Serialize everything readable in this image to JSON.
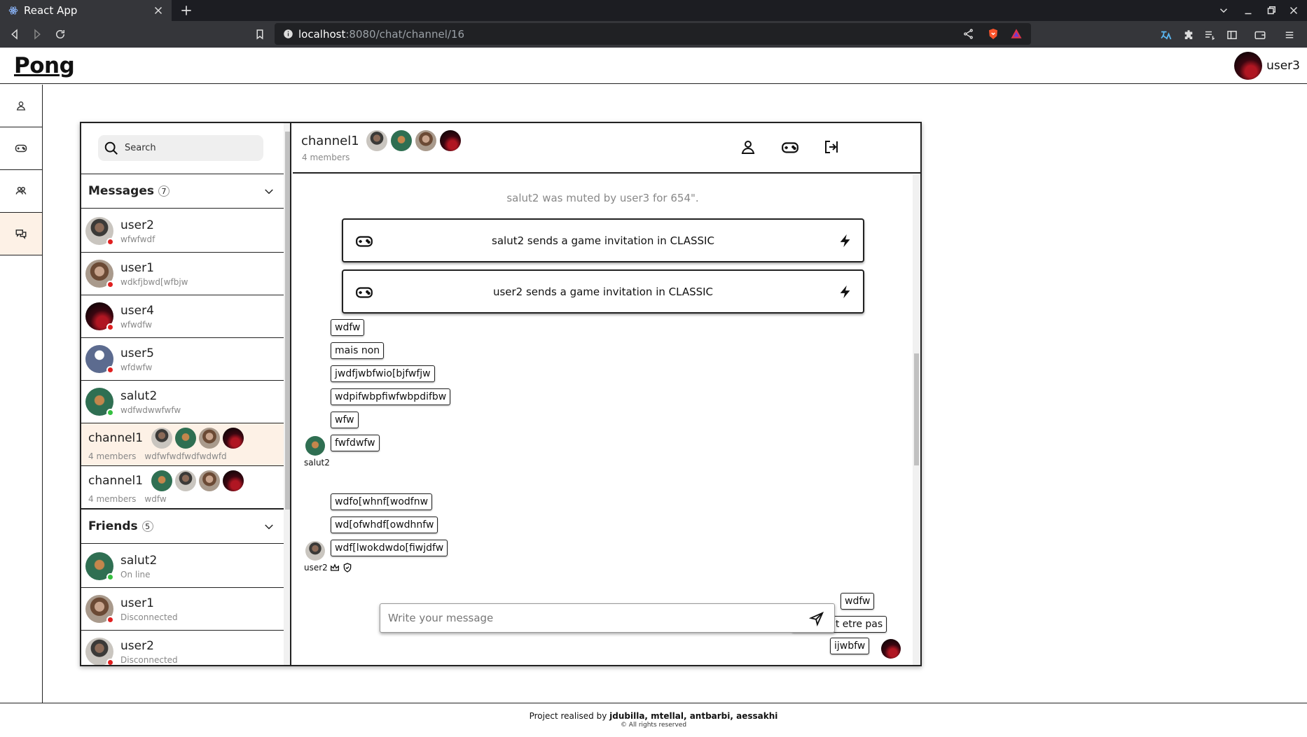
{
  "browser": {
    "tab_title": "React App",
    "url_host": "localhost",
    "url_path": ":8080/chat/channel/16"
  },
  "app": {
    "logo": "Pong",
    "current_user": "user3"
  },
  "sidebar": {
    "search_placeholder": "Search",
    "messages_title": "Messages",
    "messages_count": "7",
    "messages": [
      {
        "name": "user2",
        "preview": "wfwfwdf",
        "status": "offline"
      },
      {
        "name": "user1",
        "preview": "wdkfjbwd[wfbjw",
        "status": "offline"
      },
      {
        "name": "user4",
        "preview": "wfwdfw",
        "status": "offline"
      },
      {
        "name": "user5",
        "preview": "wfdwfw",
        "status": "offline"
      },
      {
        "name": "salut2",
        "preview": "wdfwdwwfwfw",
        "status": "online"
      }
    ],
    "channels": [
      {
        "name": "channel1",
        "members": "4 members",
        "preview": "wdfwfwdfwdfwdwfd",
        "active": true
      },
      {
        "name": "channel1",
        "members": "4 members",
        "preview": "wdfw",
        "active": false
      }
    ],
    "friends_title": "Friends",
    "friends_count": "5",
    "friends": [
      {
        "name": "salut2",
        "status_text": "On line",
        "status": "online"
      },
      {
        "name": "user1",
        "status_text": "Disconnected",
        "status": "offline"
      },
      {
        "name": "user2",
        "status_text": "Disconnected",
        "status": "offline"
      }
    ]
  },
  "chat": {
    "channel_name": "channel1",
    "members_text": "4 members",
    "system_message": "salut2 was muted by user3 for 654\".",
    "invites": [
      "salut2 sends a game invitation in CLASSIC",
      "user2 sends a game invitation in CLASSIC"
    ],
    "group_salut2": {
      "sender": "salut2",
      "messages": [
        "wdfw",
        "mais non",
        "jwdfjwbfwio[bjfwfjw",
        "wdpifwbpfiwfwbpdifbw",
        "wfw",
        "fwfdwfw"
      ]
    },
    "group_user2": {
      "sender": "user2",
      "messages": [
        "wdfo[whnf[wodfnw",
        "wd[ofwhdf[owdhnfw",
        "wdf[lwokdwdo[fiwjdfw"
      ]
    },
    "group_self": {
      "messages": [
        "wdfw",
        "oua peut etre pas",
        "ijwbfw"
      ]
    },
    "composer_placeholder": "Write your message"
  },
  "footer": {
    "prefix": "Project realised by ",
    "authors": "jdubilla, mtellal, antbarbi, aessakhi",
    "rights": "© All rights reserved"
  },
  "colors": {
    "active_bg": "#fdf1e6",
    "online": "#35c040",
    "offline": "#e02020"
  }
}
